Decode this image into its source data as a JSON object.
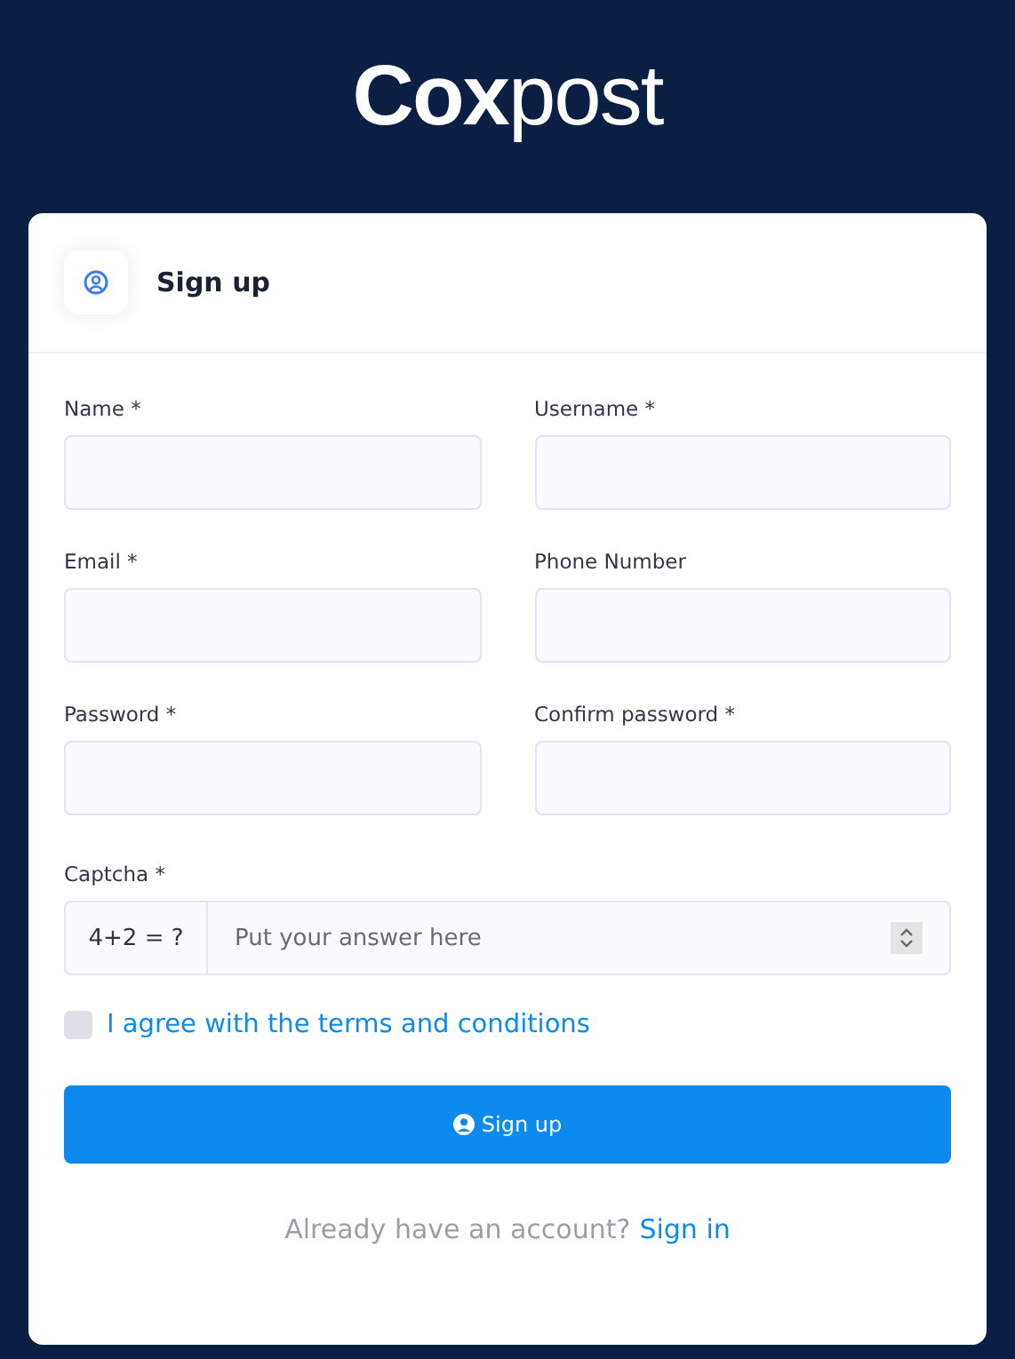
{
  "logo": "**Cox**post",
  "card": {
    "title": "Sign up"
  },
  "fields": [
    {
      "label": "Name *"
    },
    {
      "label": "Username *"
    },
    {
      "label": "Email *"
    },
    {
      "label": "Phone Number"
    },
    {
      "label": "Password *"
    },
    {
      "label": "Confirm password *"
    }
  ],
  "captcha": {
    "label": "Captcha *",
    "question": "4+2 = ?",
    "placeholder": "Put your answer here"
  },
  "terms": {
    "label": "I agree with the terms and conditions",
    "checked": false
  },
  "submit": {
    "label": "Sign up"
  },
  "footer": {
    "text": "Already have an account?",
    "link": "Sign in"
  }
}
